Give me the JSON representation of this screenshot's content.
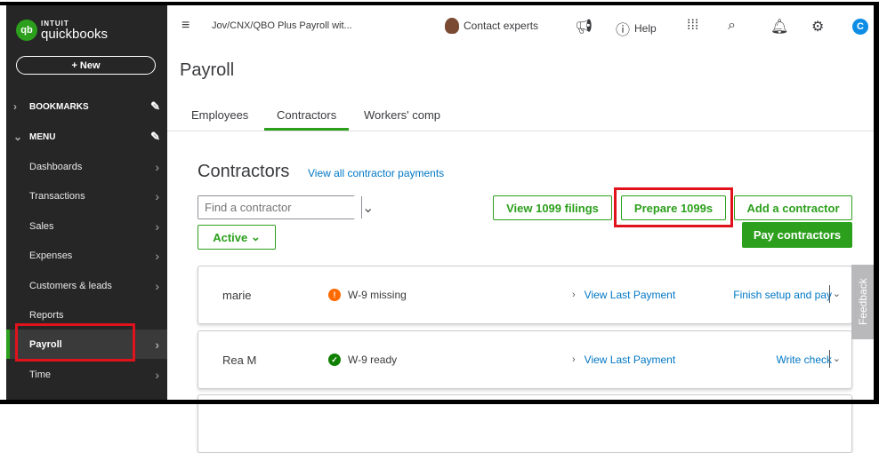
{
  "sidebar": {
    "brand_top": "INTUIT",
    "brand": "quickbooks",
    "new_label": "+ New",
    "bookmarks": "BOOKMARKS",
    "menu": "MENU",
    "items": [
      {
        "label": "Dashboards"
      },
      {
        "label": "Transactions"
      },
      {
        "label": "Sales"
      },
      {
        "label": "Expenses"
      },
      {
        "label": "Customers & leads"
      },
      {
        "label": "Reports"
      },
      {
        "label": "Payroll"
      },
      {
        "label": "Time"
      }
    ]
  },
  "topbar": {
    "company": "Jov/CNX/QBO Plus Payroll wit...",
    "contact": "Contact experts",
    "help": "Help",
    "avatar": "C"
  },
  "page": {
    "title": "Payroll",
    "tabs": [
      "Employees",
      "Contractors",
      "Workers' comp"
    ],
    "active_tab": "Contractors"
  },
  "contractors": {
    "title": "Contractors",
    "view_all": "View all contractor payments",
    "search_placeholder": "Find a contractor",
    "filter": "Active",
    "buttons": {
      "view_1099": "View 1099 filings",
      "prepare_1099": "Prepare 1099s",
      "add": "Add a contractor",
      "pay": "Pay contractors"
    },
    "rows": [
      {
        "name": "marie",
        "status": "W-9 missing",
        "view": "View Last Payment",
        "action": "Finish setup and pay"
      },
      {
        "name": "Rea M",
        "status": "W-9 ready",
        "view": "View Last Payment",
        "action": "Write check"
      }
    ]
  },
  "feedback": "Feedback",
  "colors": {
    "brand": "#2ca01c",
    "link": "#0077c5",
    "warning": "#ff6a00",
    "highlight": "#e0121b"
  }
}
